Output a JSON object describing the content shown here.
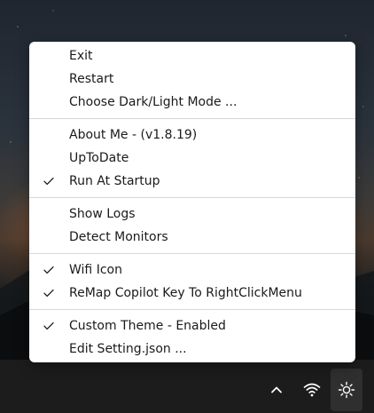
{
  "menu": {
    "groups": [
      {
        "items": [
          {
            "label": "Exit",
            "checked": false
          },
          {
            "label": "Restart",
            "checked": false
          },
          {
            "label": "Choose Dark/Light Mode ...",
            "checked": false
          }
        ]
      },
      {
        "items": [
          {
            "label": "About Me - (v1.8.19)",
            "checked": false
          },
          {
            "label": "UpToDate",
            "checked": false
          },
          {
            "label": "Run At Startup",
            "checked": true
          }
        ]
      },
      {
        "items": [
          {
            "label": "Show Logs",
            "checked": false
          },
          {
            "label": "Detect Monitors",
            "checked": false
          }
        ]
      },
      {
        "items": [
          {
            "label": "Wifi Icon",
            "checked": true
          },
          {
            "label": "ReMap Copilot Key To RightClickMenu",
            "checked": true
          }
        ]
      },
      {
        "items": [
          {
            "label": "Custom Theme - Enabled",
            "checked": true
          },
          {
            "label": "Edit Setting.json ...",
            "checked": false
          }
        ]
      }
    ]
  },
  "tray": {
    "icons": [
      "chevron-up-icon",
      "wifi-icon",
      "sun-brightness-icon"
    ]
  },
  "colors": {
    "menu_bg": "#ffffff",
    "menu_text": "#1a1a1a",
    "separator": "#d9d9d9",
    "taskbar": "#1c1c1c",
    "tray_active": "#2f2f2f"
  }
}
